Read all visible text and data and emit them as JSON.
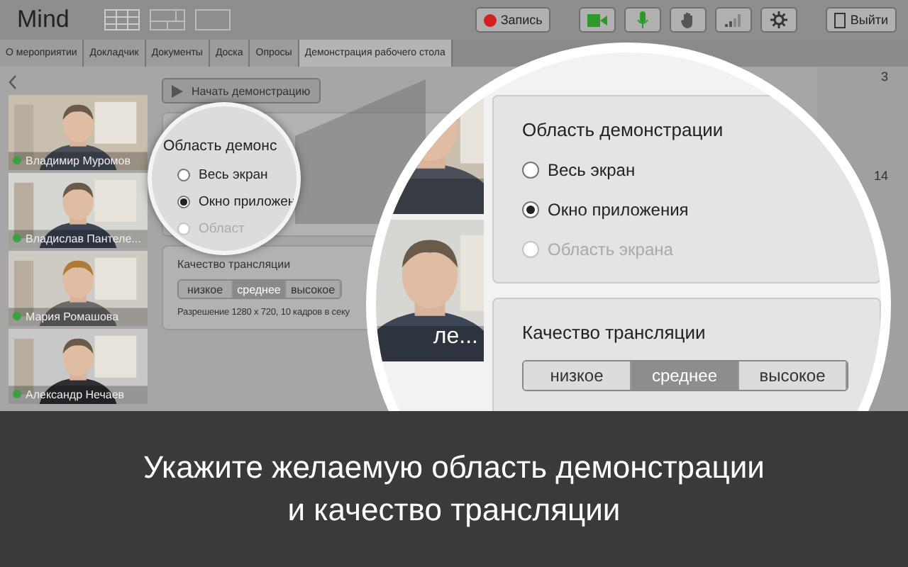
{
  "app": {
    "title": "Mind"
  },
  "toolbar": {
    "record": "Запись",
    "exit": "Выйти"
  },
  "tabs": [
    {
      "label": "О мероприятии",
      "selected": false
    },
    {
      "label": "Докладчик",
      "selected": false
    },
    {
      "label": "Документы",
      "selected": false
    },
    {
      "label": "Доска",
      "selected": false
    },
    {
      "label": "Опросы",
      "selected": false
    },
    {
      "label": "Демонстрация рабочего стола",
      "selected": true
    }
  ],
  "participants": [
    {
      "name": "Владимир Муромов"
    },
    {
      "name": "Владислав Пантеле..."
    },
    {
      "name": "Мария Ромашова"
    },
    {
      "name": "Александр Нечаев"
    }
  ],
  "start_button": "Начать демонстрацию",
  "quality": {
    "heading": "Качество трансляции",
    "options": [
      {
        "label": "низкое",
        "selected": false
      },
      {
        "label": "среднее",
        "selected": true
      },
      {
        "label": "высокое",
        "selected": false
      }
    ],
    "resolution": "Разрешение 1280 x 720, 10 кадров в секу"
  },
  "counts": [
    "3",
    "14"
  ],
  "small_magnifier": {
    "heading": "Область демонс",
    "options": [
      {
        "label": "Весь экран",
        "selected": false,
        "disabled": false
      },
      {
        "label": "Окно приложен",
        "selected": true,
        "disabled": false
      },
      {
        "label": "Област",
        "selected": false,
        "disabled": true
      }
    ]
  },
  "large_magnifier": {
    "video_label": "ле...",
    "region": {
      "heading": "Область демонстрации",
      "options": [
        {
          "label": "Весь экран",
          "selected": false,
          "disabled": false
        },
        {
          "label": "Окно приложения",
          "selected": true,
          "disabled": false
        },
        {
          "label": "Область экрана",
          "selected": false,
          "disabled": true
        }
      ]
    },
    "quality": {
      "heading": "Качество трансляции",
      "options": [
        {
          "label": "низкое",
          "selected": false
        },
        {
          "label": "среднее",
          "selected": true
        },
        {
          "label": "высокое",
          "selected": false
        }
      ]
    }
  },
  "caption": [
    "Укажите желаемую область демонстрации",
    "и качество трансляции"
  ]
}
